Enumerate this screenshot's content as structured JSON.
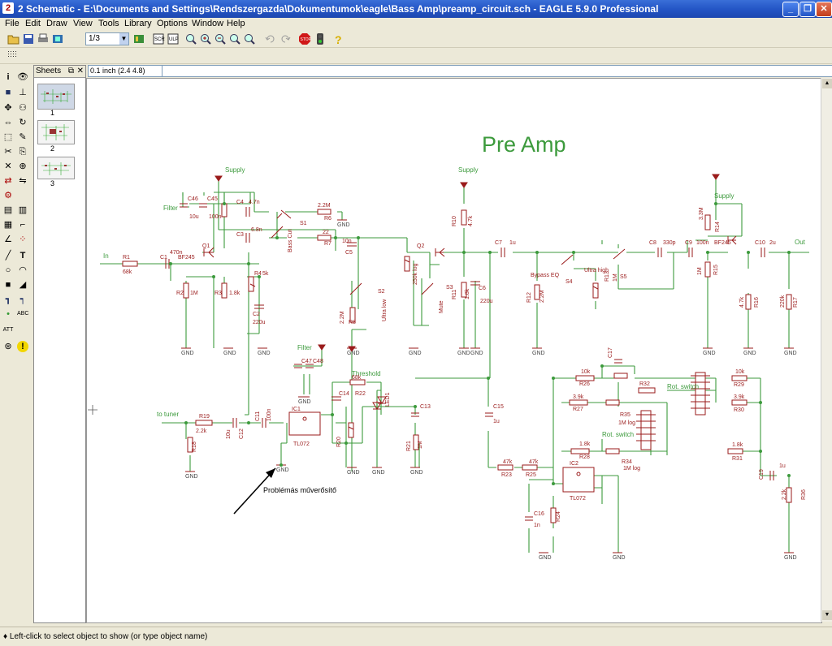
{
  "window": {
    "title": "2 Schematic - E:\\Documents and Settings\\Rendszergazda\\Dokumentumok\\eagle\\Bass Amp\\preamp_circuit.sch - EAGLE 5.9.0 Professional",
    "app_icon": "2",
    "minimize": "_",
    "maximize": "❐",
    "close": "✕"
  },
  "menu": [
    "File",
    "Edit",
    "Draw",
    "View",
    "Tools",
    "Library",
    "Options",
    "Window",
    "Help"
  ],
  "toolbar": {
    "sheet_select": "1/3",
    "icons": [
      "open-icon",
      "save-icon",
      "print-icon",
      "cam-icon",
      "sheet-select",
      "board-icon",
      "script-icon",
      "ulp-icon",
      "zoom-fit-icon",
      "zoom-in-icon",
      "zoom-out-icon",
      "redraw-icon",
      "zoom-select-icon",
      "undo-icon",
      "redo-icon",
      "stop-icon",
      "go-icon",
      "help-icon"
    ]
  },
  "sheets_panel": {
    "title": "Sheets",
    "items": [
      "1",
      "2",
      "3"
    ]
  },
  "coord_display": "0.1 inch (2.4 4.8)",
  "status_text": "Left-click to select object to show (or type object name)",
  "schematic": {
    "title": "Pre Amp",
    "annotation": "Problémás műverősítő",
    "labels": {
      "supply1": "Supply",
      "supply2": "Supply",
      "supply3": "Supply",
      "filter1": "Filter",
      "filter2": "Filter",
      "in": "In",
      "out": "Out",
      "to_tuner": "to tuner",
      "r1": "R1",
      "r1v": "68k",
      "c1": "C1",
      "c1v": "470n",
      "q1": "Q1",
      "q1v": "BF245",
      "r2": "R2",
      "r2v": "1M",
      "r3": "R3",
      "r3v": "1.8k",
      "r4": "R4",
      "r4v": "5k",
      "c2": "C2",
      "c2v": "220u",
      "c45": "C45",
      "c45v": "100n",
      "c46": "C46",
      "c46v": "10u",
      "c4": "C4",
      "c4v": "4.7n",
      "c3": "C3",
      "c3v": "6.8n",
      "r6": "R6",
      "r6v": "2.2M",
      "r7": "R7",
      "r7v": "22",
      "s1": "S1",
      "s1l": "Bass Cut",
      "c5": "C5",
      "c5v": "10n",
      "r8": "R8",
      "r8v": "2.2M",
      "s2": "S2",
      "s2l": "Ultra low",
      "q2": "Q2",
      "r9v": "250k log",
      "s3": "S3",
      "s3l": "Mute",
      "r10": "R10",
      "r10v": "4.7k",
      "r11": "R11",
      "r11v": "1.8k",
      "c6": "C6",
      "c6v": "220u",
      "c7": "C7",
      "c7v": "1u",
      "r12": "R12",
      "r12v": "2.2M",
      "bypass": "Bypass EQ",
      "s4": "S4",
      "r13": "R13",
      "r13v": "1M",
      "s5": "S5",
      "ultrahigh": "Ultra high",
      "c8": "C8",
      "c8v": "330p",
      "c9": "C9",
      "c9v": "100n",
      "q3v": "BF245",
      "r14": "R14",
      "r14v": "3.3M",
      "r15": "R15",
      "r15v": "1M",
      "r16": "R16",
      "r16v": "4.7k",
      "c10": "C10",
      "c10v": "2u",
      "r17": "R17",
      "r17v": "220k",
      "gnd": "GND",
      "ic1": "IC1",
      "ic1v": "TL072",
      "ic2": "IC2",
      "ic2v": "TL072",
      "r19": "R19",
      "r19v": "2.2k",
      "r18": "R18",
      "c11": "C11",
      "c11v": "100n",
      "c12": "C12",
      "c12v": "10u",
      "c47": "C47",
      "c48": "C48",
      "c14": "C14",
      "r22": "R22",
      "r22v": "68k",
      "threshold": "Threshold",
      "led1": "LED1",
      "r20": "R20",
      "r21a": "R21",
      "r21av": "1M",
      "c13": "C13",
      "c15": "C15",
      "c15v": "1u",
      "r23": "R23",
      "r23v": "47k",
      "r25": "R25",
      "r25v": "47k",
      "c16": "C16",
      "c16v": "1n",
      "r24": "R24",
      "c17": "C17",
      "r26": "R26",
      "r26v": "10k",
      "r27": "R27",
      "r27v": "3.9k",
      "r28": "R28",
      "r28v": "1.8k",
      "r32": "R32",
      "r35": "R35",
      "r35v": "1M log",
      "r34": "R34",
      "r34v": "1M log",
      "rot1": "Rot. switch",
      "rot2": "Rot. switch",
      "r29": "R29",
      "r29v": "10k",
      "r30": "R30",
      "r30v": "3.9k",
      "r31": "R31",
      "r31v": "1.8k",
      "c19": "C19",
      "c19v": "1u",
      "r36": "R36",
      "r36v": "2.2k"
    }
  }
}
